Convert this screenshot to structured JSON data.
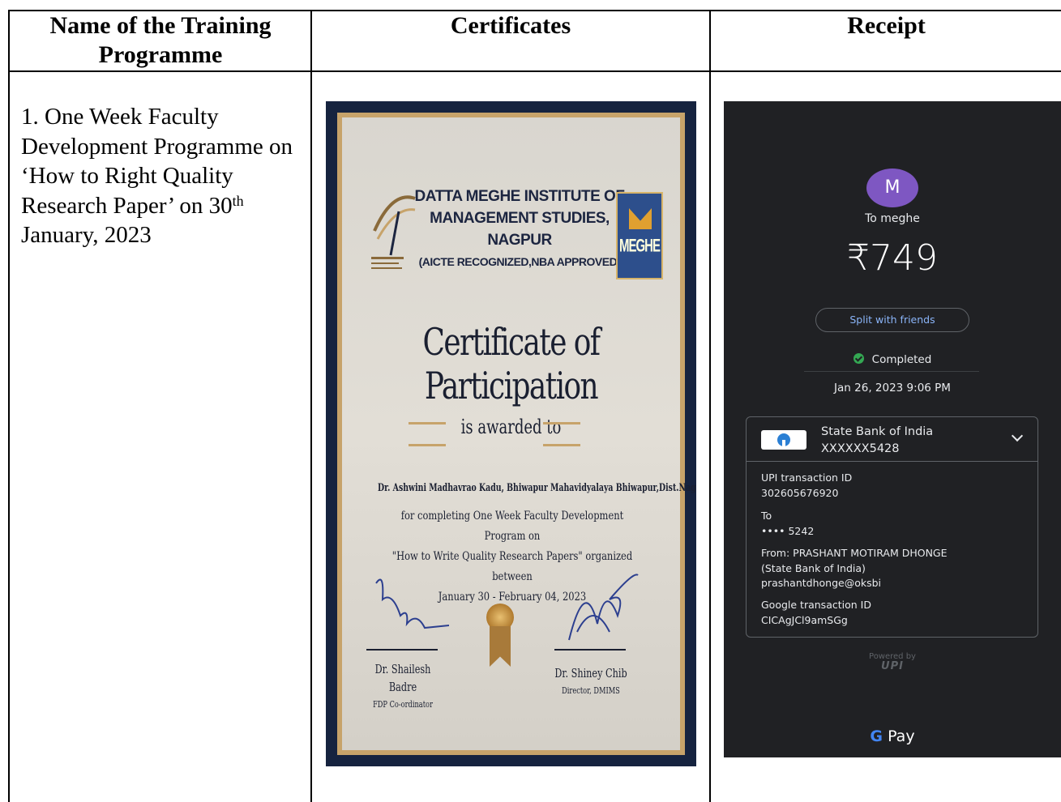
{
  "table": {
    "headers": [
      "Name of the Training Programme",
      "Certificates",
      "Receipt"
    ]
  },
  "programme": {
    "text_before": "1. One Week Faculty Development Programme on ‘How to Right Quality Research Paper’ on 30",
    "superscript": "th",
    "text_after": " January, 2023"
  },
  "certificate": {
    "institute_lines": [
      "DATTA MEGHE INSTITUTE OF",
      "MANAGEMENT STUDIES,",
      "NAGPUR",
      "(AICTE RECOGNIZED,NBA APPROVED)"
    ],
    "brand": "MEGHE",
    "title": "Certificate of Participation",
    "awarded": "is awarded to",
    "recipient": "Dr. Ashwini Madhavrao Kadu, Bhiwapur Mahavidyalaya Bhiwapur,Dist.Nagpur, Maharashtra",
    "description_lines": [
      "for completing One Week Faculty Development Program on",
      "\"How to Write Quality Research Papers\" organized between",
      "January 30 - February 04, 2023"
    ],
    "signatories": [
      {
        "name": "Dr. Shailesh Badre",
        "role": "FDP Co-ordinator"
      },
      {
        "name": "Dr. Shiney Chib",
        "role": "Director, DMIMS"
      }
    ],
    "colors": {
      "navy": "#16233f",
      "gold": "#c7a36a"
    }
  },
  "receipt": {
    "avatar_letter": "M",
    "to": "To meghe",
    "amount": "₹749",
    "split_button": "Split with friends",
    "status": "Completed",
    "datetime": "Jan 26, 2023 9:06 PM",
    "bank_name": "State Bank of India",
    "bank_account": "XXXXXX5428",
    "upi_label": "UPI transaction ID",
    "upi_id": "302605676920",
    "to_label": "To",
    "to_account": "•••• 5242",
    "from_line": "From: PRASHANT MOTIRAM DHONGE",
    "from_bank": "(State Bank of India)",
    "from_upi": "prashantdhonge@oksbi",
    "google_label": "Google transaction ID",
    "google_id": "CICAgJCl9amSGg",
    "powered_by": "Powered by",
    "upi_logo": "UPI",
    "gpay_g": "G",
    "gpay_text": " Pay",
    "colors": {
      "background": "#202124",
      "avatar": "#7e57c2",
      "link": "#8ab4f8",
      "success": "#34a853"
    }
  }
}
